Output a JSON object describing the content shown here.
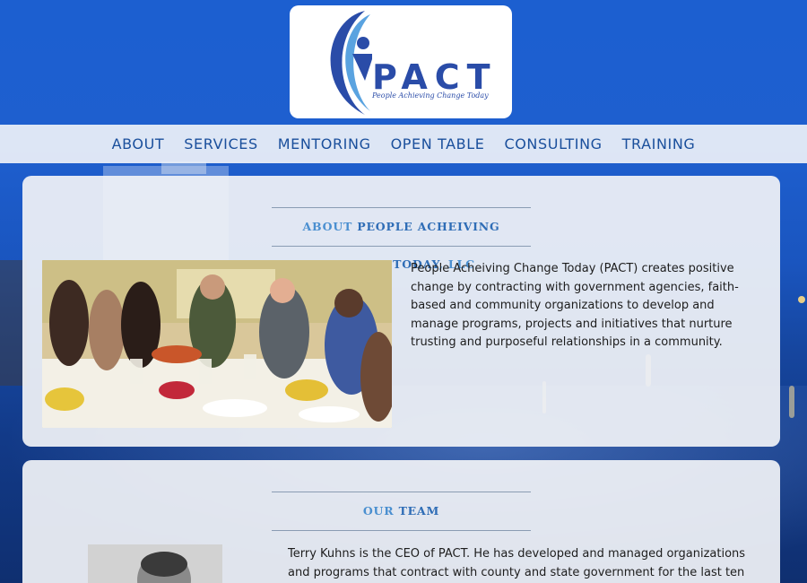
{
  "logo": {
    "wordmark": "PACT",
    "tagline": "People Achieving Change Today",
    "alt": "PACT logo",
    "colors": {
      "primary": "#2a4ca8",
      "swoosh": "#5aa3e0"
    }
  },
  "nav": {
    "items": [
      {
        "label": "ABOUT"
      },
      {
        "label": "SERVICES"
      },
      {
        "label": "MENTORING"
      },
      {
        "label": "OPEN TABLE"
      },
      {
        "label": "CONSULTING"
      },
      {
        "label": "TRAINING"
      }
    ]
  },
  "about": {
    "heading_lead": "About ",
    "heading_strong": "People Acheiving Change Today",
    "heading_tail": ", LLC",
    "body": "People Acheiving Change Today (PACT) creates positive change by contracting with government agencies, faith-based and community organizations to develop and manage programs, projects and initiatives that nurture trusting and purposeful relationships in a community.",
    "photo_icon": "group-dining-photo"
  },
  "team": {
    "heading_lead": "Our ",
    "heading_strong": "Team",
    "body": "Terry Kuhns is the CEO of PACT. He has developed and managed organizations and programs that contract with county and state government for the last ten years. In",
    "photo_icon": "portrait-photo"
  },
  "colors": {
    "nav_text": "#1a4f9c",
    "heading_light": "#4a8fd0",
    "heading_strong": "#2f6db6",
    "background": "#1e5fcf"
  }
}
